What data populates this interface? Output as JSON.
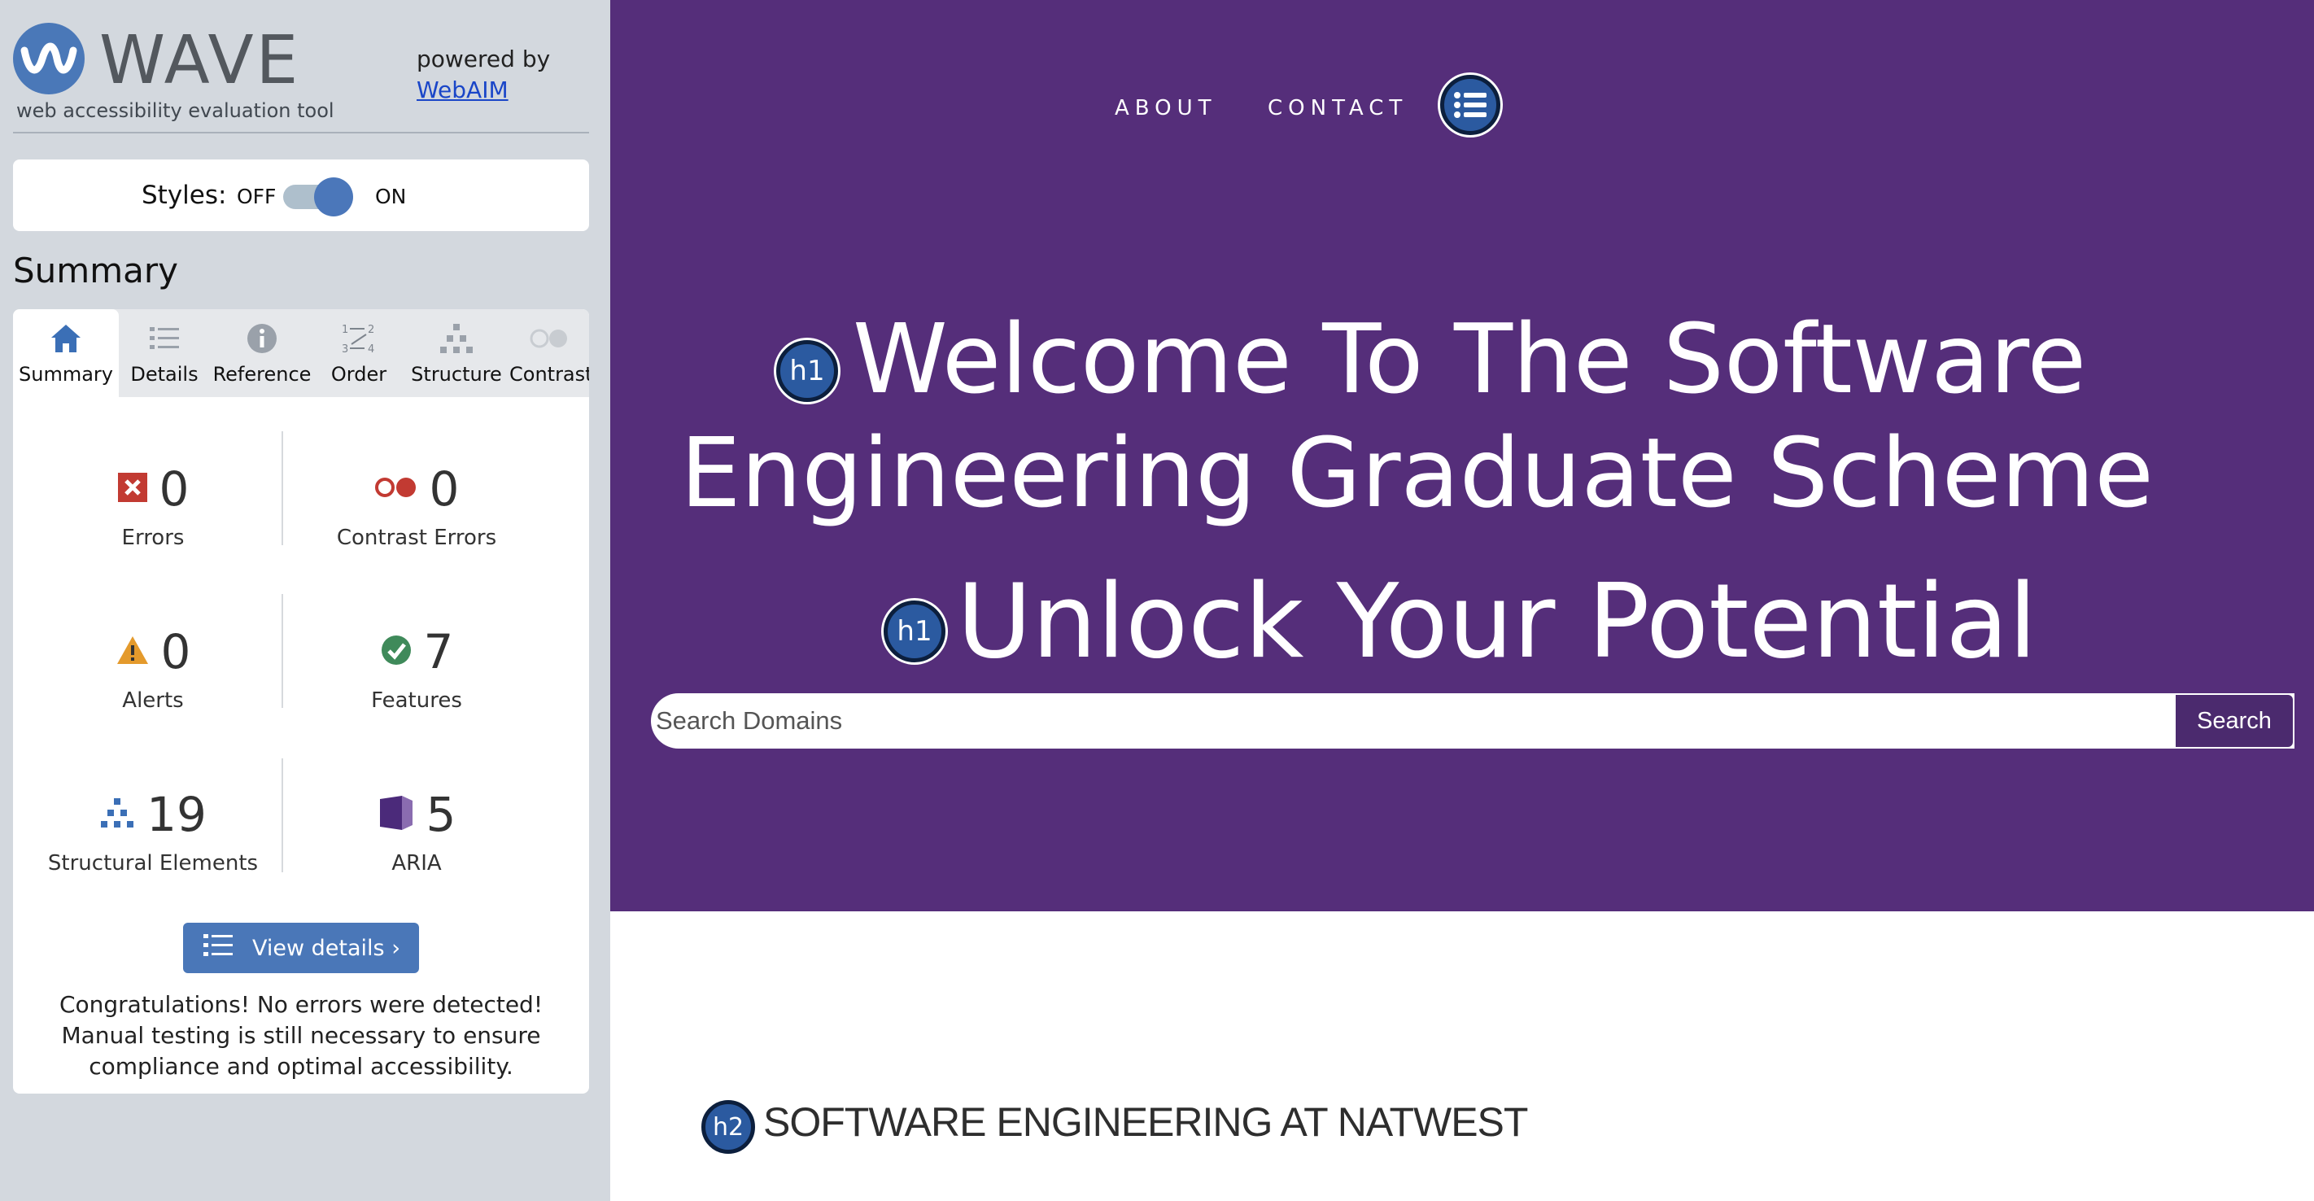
{
  "wave": {
    "logo_text": "WAVE",
    "tagline": "web accessibility evaluation tool",
    "powered_by": "powered by",
    "powered_link": "WebAIM",
    "styles": {
      "label": "Styles:",
      "off": "OFF",
      "on": "ON",
      "state": "on"
    },
    "summary_heading": "Summary",
    "tabs": [
      {
        "label": "Summary",
        "icon": "home-icon",
        "active": true
      },
      {
        "label": "Details",
        "icon": "list-icon",
        "active": false
      },
      {
        "label": "Reference",
        "icon": "info-icon",
        "active": false
      },
      {
        "label": "Order",
        "icon": "order-icon",
        "active": false
      },
      {
        "label": "Structure",
        "icon": "structure-icon",
        "active": false
      },
      {
        "label": "Contrast",
        "icon": "contrast-icon",
        "active": false
      }
    ],
    "stats": {
      "errors": {
        "count": "0",
        "label": "Errors",
        "icon": "error-icon",
        "color": "#c23a32"
      },
      "contrast_errors": {
        "count": "0",
        "label": "Contrast Errors",
        "icon": "contrast-error-icon",
        "color": "#c23a32"
      },
      "alerts": {
        "count": "0",
        "label": "Alerts",
        "icon": "alert-icon",
        "color": "#e49a2c"
      },
      "features": {
        "count": "7",
        "label": "Features",
        "icon": "feature-check-icon",
        "color": "#3f8a5a"
      },
      "structural": {
        "count": "19",
        "label": "Structural Elements",
        "icon": "structure-icon",
        "color": "#3b6fb6"
      },
      "aria": {
        "count": "5",
        "label": "ARIA",
        "icon": "aria-icon",
        "color": "#4b2a7a"
      }
    },
    "view_details": "View details ›",
    "congrats": "Congratulations! No errors were detected! Manual testing is still necessary to ensure compliance and optimal accessibility."
  },
  "page": {
    "nav": {
      "about": "ABOUT",
      "contact": "CONTACT"
    },
    "hero_line1": "Welcome To The Software",
    "hero_line2": "Engineering Graduate Scheme",
    "hero_second": "Unlock Your Potential",
    "search_placeholder": "Search Domains",
    "search_button": "Search",
    "h2": "SOFTWARE ENGINEERING AT NATWEST",
    "badge_h1": "h1",
    "badge_h2": "h2",
    "hero_color": "#552e7a"
  }
}
